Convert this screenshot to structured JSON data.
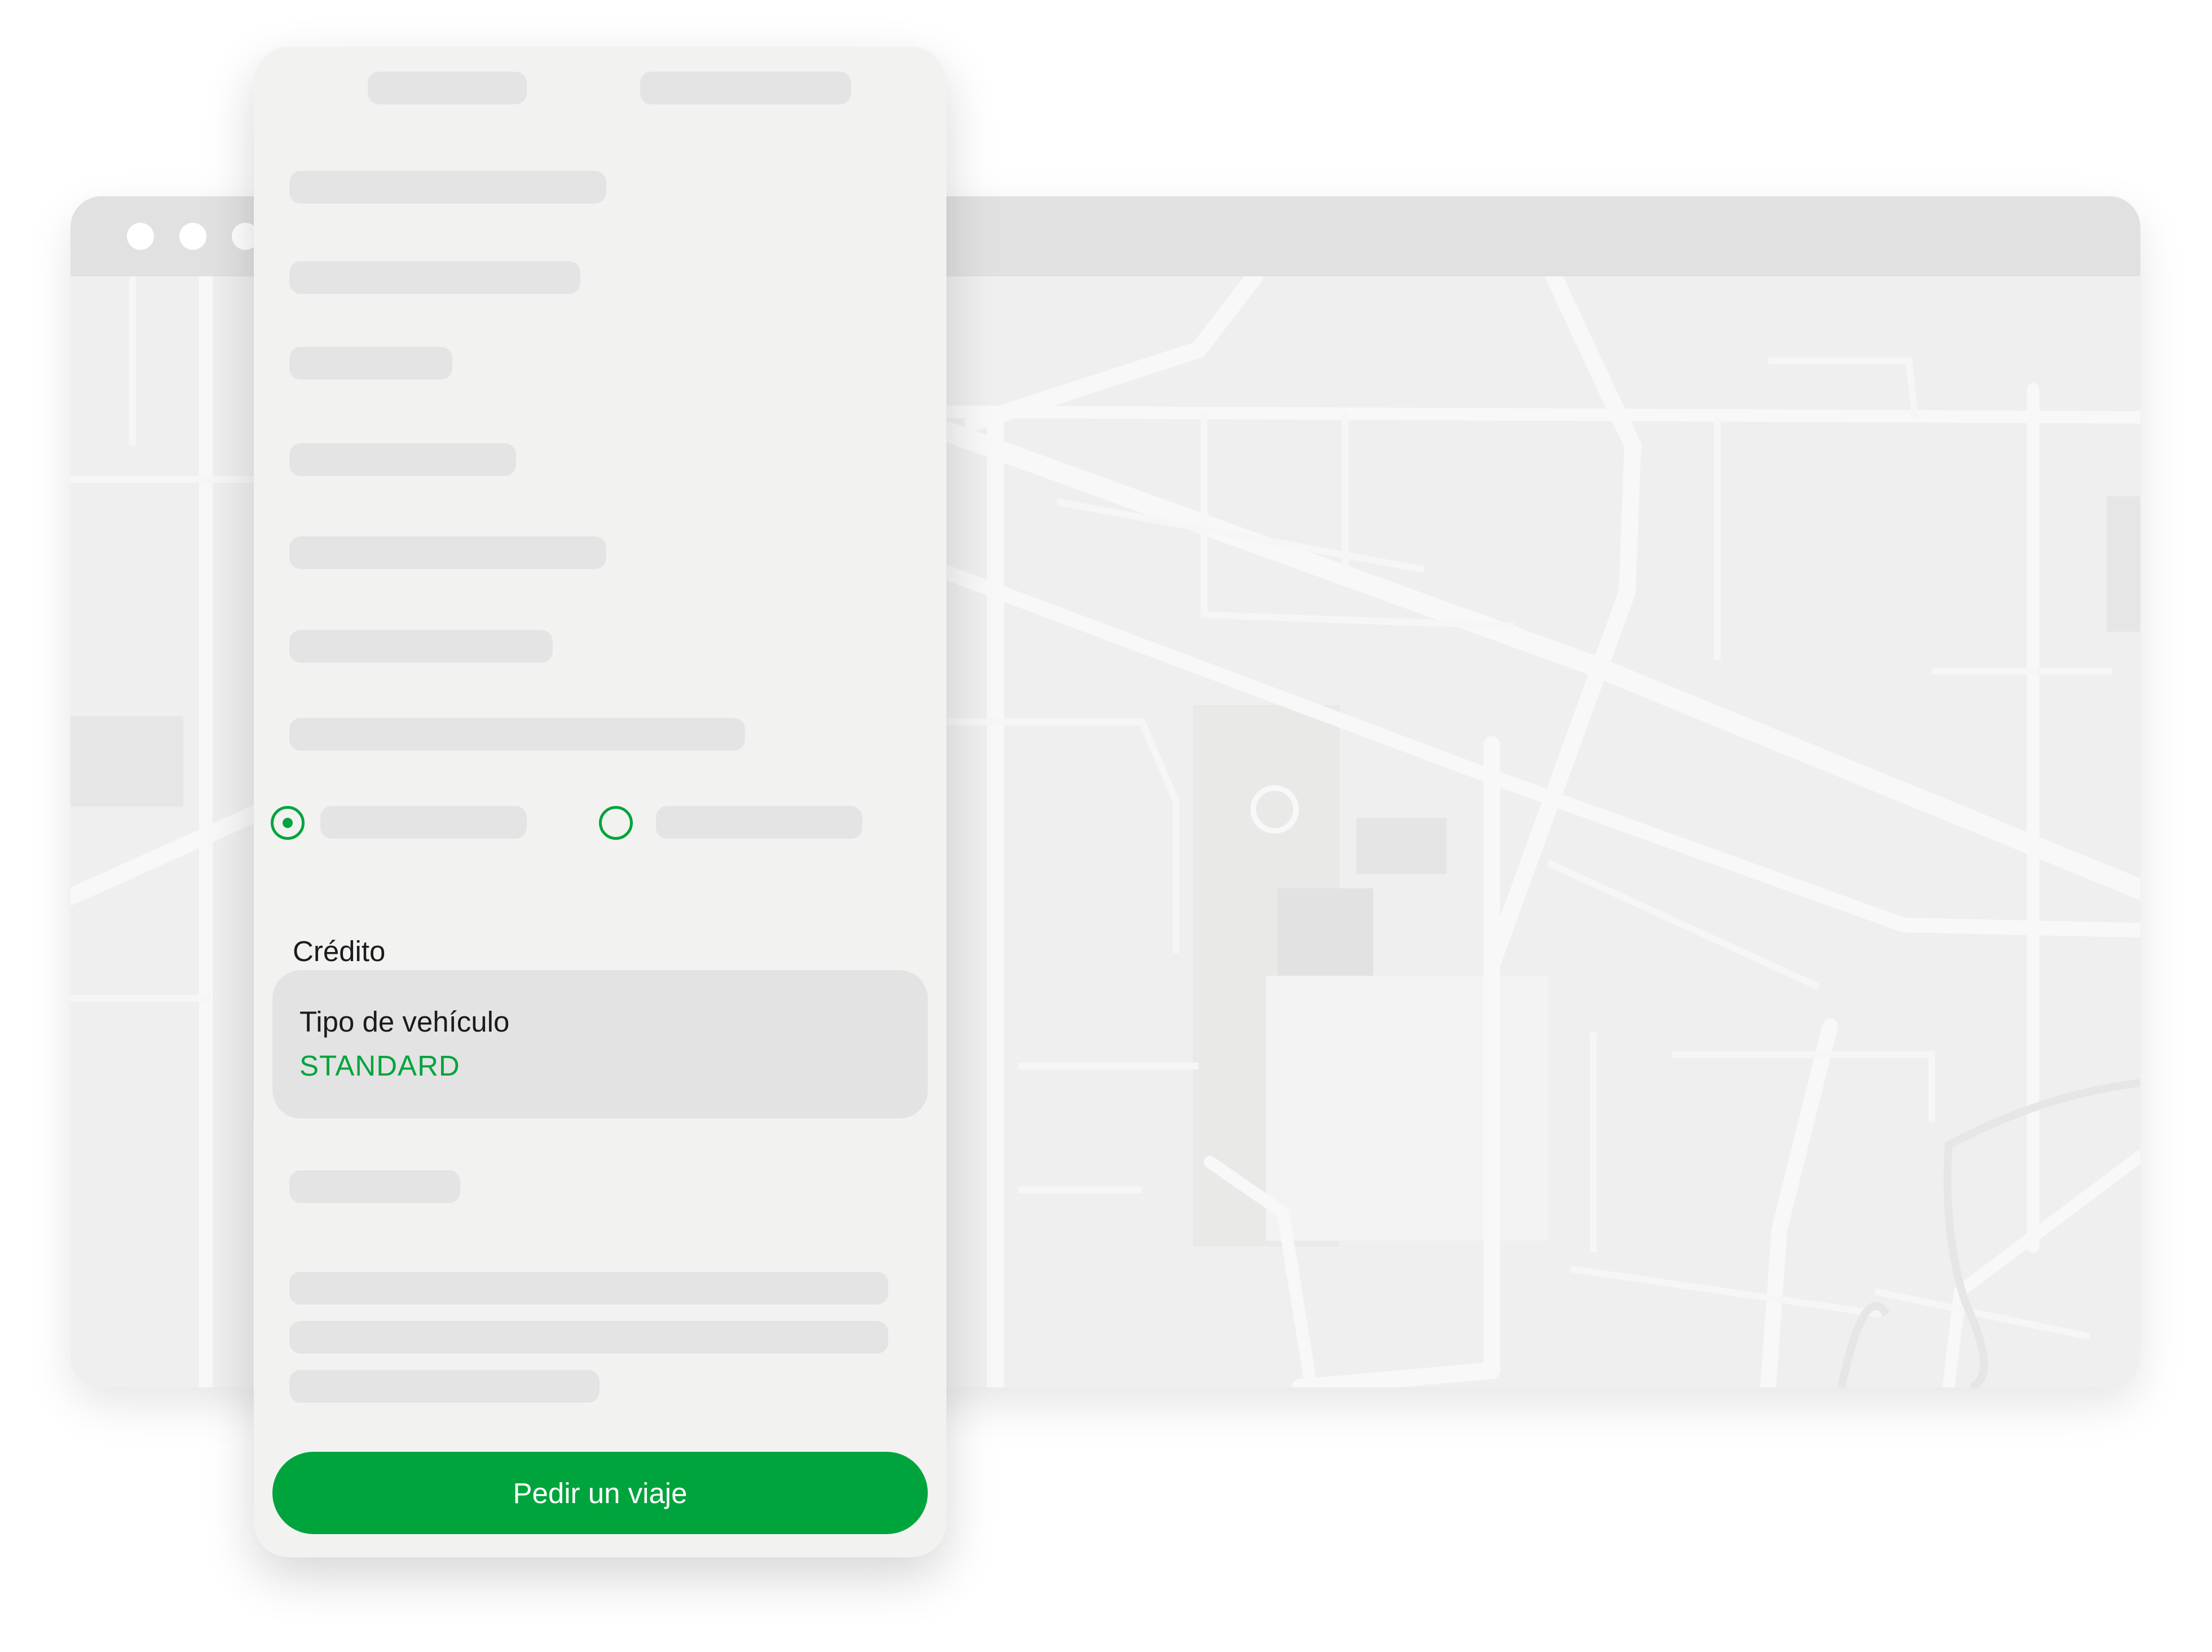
{
  "browser": {
    "window_controls": [
      "close-dot",
      "minimize-dot",
      "maximize-dot"
    ]
  },
  "map": {
    "icon": "map-background"
  },
  "ride_form": {
    "payment_radios": {
      "selected_index": 0
    },
    "payment_label": "Crédito",
    "vehicle": {
      "title": "Tipo de vehículo",
      "value": "STANDARD"
    },
    "request_button": "Pedir un viaje"
  },
  "colors": {
    "accent": "#00a43d",
    "panel_bg": "#f2f2f1",
    "skeleton": "#e4e4e4",
    "map_bg": "#efefef",
    "road": "#f8f8f8",
    "browser_bar": "#e1e1e1"
  }
}
